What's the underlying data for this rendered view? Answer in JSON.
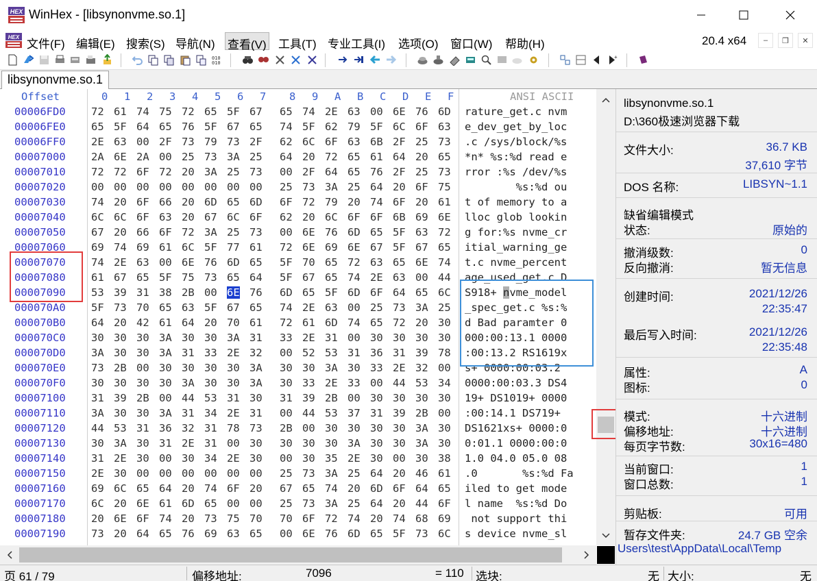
{
  "window": {
    "title": "WinHex - [libsynonvme.so.1]"
  },
  "menu": {
    "items": [
      "文件(F)",
      "编辑(E)",
      "搜索(S)",
      "导航(N)",
      "查看(V)",
      "工具(T)",
      "专业工具(I)",
      "选项(O)",
      "窗口(W)",
      "帮助(H)"
    ],
    "active": "查看(V)",
    "zoom": "20.4 x64"
  },
  "tab": {
    "label": "libsynonvme.so.1"
  },
  "hex": {
    "offset_header": "Offset",
    "column_headers": [
      "0",
      "1",
      "2",
      "3",
      "4",
      "5",
      "6",
      "7",
      "8",
      "9",
      "A",
      "B",
      "C",
      "D",
      "E",
      "F"
    ],
    "ascii_header": "ANSI ASCII",
    "rows": [
      {
        "offset": "00006FD0",
        "bytes": [
          "72",
          "61",
          "74",
          "75",
          "72",
          "65",
          "5F",
          "67",
          "65",
          "74",
          "2E",
          "63",
          "00",
          "6E",
          "76",
          "6D"
        ],
        "ascii": "rature_get.c nvm"
      },
      {
        "offset": "00006FE0",
        "bytes": [
          "65",
          "5F",
          "64",
          "65",
          "76",
          "5F",
          "67",
          "65",
          "74",
          "5F",
          "62",
          "79",
          "5F",
          "6C",
          "6F",
          "63"
        ],
        "ascii": "e_dev_get_by_loc"
      },
      {
        "offset": "00006FF0",
        "bytes": [
          "2E",
          "63",
          "00",
          "2F",
          "73",
          "79",
          "73",
          "2F",
          "62",
          "6C",
          "6F",
          "63",
          "6B",
          "2F",
          "25",
          "73"
        ],
        "ascii": ".c /sys/block/%s"
      },
      {
        "offset": "00007000",
        "bytes": [
          "2A",
          "6E",
          "2A",
          "00",
          "25",
          "73",
          "3A",
          "25",
          "64",
          "20",
          "72",
          "65",
          "61",
          "64",
          "20",
          "65"
        ],
        "ascii": "*n* %s:%d read e"
      },
      {
        "offset": "00007010",
        "bytes": [
          "72",
          "72",
          "6F",
          "72",
          "20",
          "3A",
          "25",
          "73",
          "00",
          "2F",
          "64",
          "65",
          "76",
          "2F",
          "25",
          "73"
        ],
        "ascii": "rror :%s /dev/%s"
      },
      {
        "offset": "00007020",
        "bytes": [
          "00",
          "00",
          "00",
          "00",
          "00",
          "00",
          "00",
          "00",
          "25",
          "73",
          "3A",
          "25",
          "64",
          "20",
          "6F",
          "75"
        ],
        "ascii": "        %s:%d ou"
      },
      {
        "offset": "00007030",
        "bytes": [
          "74",
          "20",
          "6F",
          "66",
          "20",
          "6D",
          "65",
          "6D",
          "6F",
          "72",
          "79",
          "20",
          "74",
          "6F",
          "20",
          "61"
        ],
        "ascii": "t of memory to a"
      },
      {
        "offset": "00007040",
        "bytes": [
          "6C",
          "6C",
          "6F",
          "63",
          "20",
          "67",
          "6C",
          "6F",
          "62",
          "20",
          "6C",
          "6F",
          "6F",
          "6B",
          "69",
          "6E"
        ],
        "ascii": "lloc glob lookin"
      },
      {
        "offset": "00007050",
        "bytes": [
          "67",
          "20",
          "66",
          "6F",
          "72",
          "3A",
          "25",
          "73",
          "00",
          "6E",
          "76",
          "6D",
          "65",
          "5F",
          "63",
          "72"
        ],
        "ascii": "g for:%s nvme_cr"
      },
      {
        "offset": "00007060",
        "bytes": [
          "69",
          "74",
          "69",
          "61",
          "6C",
          "5F",
          "77",
          "61",
          "72",
          "6E",
          "69",
          "6E",
          "67",
          "5F",
          "67",
          "65"
        ],
        "ascii": "itial_warning_ge"
      },
      {
        "offset": "00007070",
        "bytes": [
          "74",
          "2E",
          "63",
          "00",
          "6E",
          "76",
          "6D",
          "65",
          "5F",
          "70",
          "65",
          "72",
          "63",
          "65",
          "6E",
          "74"
        ],
        "ascii": "t.c nvme_percent"
      },
      {
        "offset": "00007080",
        "bytes": [
          "61",
          "67",
          "65",
          "5F",
          "75",
          "73",
          "65",
          "64",
          "5F",
          "67",
          "65",
          "74",
          "2E",
          "63",
          "00",
          "44"
        ],
        "ascii": "age_used_get.c D"
      },
      {
        "offset": "00007090",
        "bytes": [
          "53",
          "39",
          "31",
          "38",
          "2B",
          "00",
          "6E",
          "76",
          "6D",
          "65",
          "5F",
          "6D",
          "6F",
          "64",
          "65",
          "6C"
        ],
        "ascii": "S918+ nvme_model"
      },
      {
        "offset": "000070A0",
        "bytes": [
          "5F",
          "73",
          "70",
          "65",
          "63",
          "5F",
          "67",
          "65",
          "74",
          "2E",
          "63",
          "00",
          "25",
          "73",
          "3A",
          "25"
        ],
        "ascii": "_spec_get.c %s:%"
      },
      {
        "offset": "000070B0",
        "bytes": [
          "64",
          "20",
          "42",
          "61",
          "64",
          "20",
          "70",
          "61",
          "72",
          "61",
          "6D",
          "74",
          "65",
          "72",
          "20",
          "30"
        ],
        "ascii": "d Bad paramter 0"
      },
      {
        "offset": "000070C0",
        "bytes": [
          "30",
          "30",
          "30",
          "3A",
          "30",
          "30",
          "3A",
          "31",
          "33",
          "2E",
          "31",
          "00",
          "30",
          "30",
          "30",
          "30"
        ],
        "ascii": "000:00:13.1 0000"
      },
      {
        "offset": "000070D0",
        "bytes": [
          "3A",
          "30",
          "30",
          "3A",
          "31",
          "33",
          "2E",
          "32",
          "00",
          "52",
          "53",
          "31",
          "36",
          "31",
          "39",
          "78"
        ],
        "ascii": ":00:13.2 RS1619x"
      },
      {
        "offset": "000070E0",
        "bytes": [
          "73",
          "2B",
          "00",
          "30",
          "30",
          "30",
          "30",
          "3A",
          "30",
          "30",
          "3A",
          "30",
          "33",
          "2E",
          "32",
          "00"
        ],
        "ascii": "s+ 0000:00:03.2 "
      },
      {
        "offset": "000070F0",
        "bytes": [
          "30",
          "30",
          "30",
          "30",
          "3A",
          "30",
          "30",
          "3A",
          "30",
          "33",
          "2E",
          "33",
          "00",
          "44",
          "53",
          "34"
        ],
        "ascii": "0000:00:03.3 DS4"
      },
      {
        "offset": "00007100",
        "bytes": [
          "31",
          "39",
          "2B",
          "00",
          "44",
          "53",
          "31",
          "30",
          "31",
          "39",
          "2B",
          "00",
          "30",
          "30",
          "30",
          "30"
        ],
        "ascii": "19+ DS1019+ 0000"
      },
      {
        "offset": "00007110",
        "bytes": [
          "3A",
          "30",
          "30",
          "3A",
          "31",
          "34",
          "2E",
          "31",
          "00",
          "44",
          "53",
          "37",
          "31",
          "39",
          "2B",
          "00"
        ],
        "ascii": ":00:14.1 DS719+ "
      },
      {
        "offset": "00007120",
        "bytes": [
          "44",
          "53",
          "31",
          "36",
          "32",
          "31",
          "78",
          "73",
          "2B",
          "00",
          "30",
          "30",
          "30",
          "30",
          "3A",
          "30"
        ],
        "ascii": "DS1621xs+ 0000:0"
      },
      {
        "offset": "00007130",
        "bytes": [
          "30",
          "3A",
          "30",
          "31",
          "2E",
          "31",
          "00",
          "30",
          "30",
          "30",
          "30",
          "3A",
          "30",
          "30",
          "3A",
          "30"
        ],
        "ascii": "0:01.1 0000:00:0"
      },
      {
        "offset": "00007140",
        "bytes": [
          "31",
          "2E",
          "30",
          "00",
          "30",
          "34",
          "2E",
          "30",
          "00",
          "30",
          "35",
          "2E",
          "30",
          "00",
          "30",
          "38"
        ],
        "ascii": "1.0 04.0 05.0 08"
      },
      {
        "offset": "00007150",
        "bytes": [
          "2E",
          "30",
          "00",
          "00",
          "00",
          "00",
          "00",
          "00",
          "25",
          "73",
          "3A",
          "25",
          "64",
          "20",
          "46",
          "61"
        ],
        "ascii": ".0       %s:%d Fa"
      },
      {
        "offset": "00007160",
        "bytes": [
          "69",
          "6C",
          "65",
          "64",
          "20",
          "74",
          "6F",
          "20",
          "67",
          "65",
          "74",
          "20",
          "6D",
          "6F",
          "64",
          "65"
        ],
        "ascii": "iled to get mode"
      },
      {
        "offset": "00007170",
        "bytes": [
          "6C",
          "20",
          "6E",
          "61",
          "6D",
          "65",
          "00",
          "00",
          "25",
          "73",
          "3A",
          "25",
          "64",
          "20",
          "44",
          "6F"
        ],
        "ascii": "l name  %s:%d Do"
      },
      {
        "offset": "00007180",
        "bytes": [
          "20",
          "6E",
          "6F",
          "74",
          "20",
          "73",
          "75",
          "70",
          "70",
          "6F",
          "72",
          "74",
          "20",
          "74",
          "68",
          "69"
        ],
        "ascii": " not support thi"
      },
      {
        "offset": "00007190",
        "bytes": [
          "73",
          "20",
          "64",
          "65",
          "76",
          "69",
          "63",
          "65",
          "00",
          "6E",
          "76",
          "6D",
          "65",
          "5F",
          "73",
          "6C"
        ],
        "ascii": "s device nvme_sl"
      }
    ]
  },
  "info": {
    "filename": "libsynonvme.so.1",
    "path": "D:\\360极速浏览器下载",
    "file_size_label": "文件大小:",
    "file_size_kb": "36.7 KB",
    "file_size_bytes": "37,610 字节",
    "dos_name_label": "DOS 名称:",
    "dos_name": "LIBSYN~1.1",
    "default_edit_mode_label": "缺省编辑模式",
    "state_label": "状态:",
    "state_value": "原始的",
    "undo_level_label": "撤消级数:",
    "undo_level_value": "0",
    "reverse_undo_label": "反向撤消:",
    "reverse_undo_value": "暂无信息",
    "created_label": "创建时间:",
    "created_date": "2021/12/26",
    "created_time": "22:35:47",
    "modified_label": "最后写入时间:",
    "modified_date": "2021/12/26",
    "modified_time": "22:35:48",
    "attributes_label": "属性:",
    "attributes_value": "A",
    "icon_label": "图标:",
    "icon_value": "0",
    "mode_label": "模式:",
    "mode_value": "十六进制",
    "offset_mode_label": "偏移地址:",
    "offset_mode_value": "十六进制",
    "bytes_per_page_label": "每页字节数:",
    "bytes_per_page_value": "30x16=480",
    "current_window_label": "当前窗口:",
    "current_window_value": "1",
    "window_count_label": "窗口总数:",
    "window_count_value": "1",
    "clipboard_label": "剪贴板:",
    "clipboard_value": "可用",
    "temp_folder_label": "暂存文件夹:",
    "temp_folder_value": "24.7 GB 空余",
    "temp_folder_path": "Users\\test\\AppData\\Local\\Temp"
  },
  "status": {
    "page": "页 61 / 79",
    "offset_label": "偏移地址:",
    "offset_value": "7096",
    "eq_value": "= 110",
    "selection_label": "选块:",
    "selection_value": "无",
    "size_label": "大小:",
    "size_value": "无"
  },
  "colors": {
    "offset_text": "#3636c8",
    "header_text": "#3a5fcd",
    "highlight_byte": "#1a3fcf",
    "annotation_red": "#e23c3c",
    "annotation_blue": "#3d8fd8",
    "info_value": "#1833b0"
  }
}
